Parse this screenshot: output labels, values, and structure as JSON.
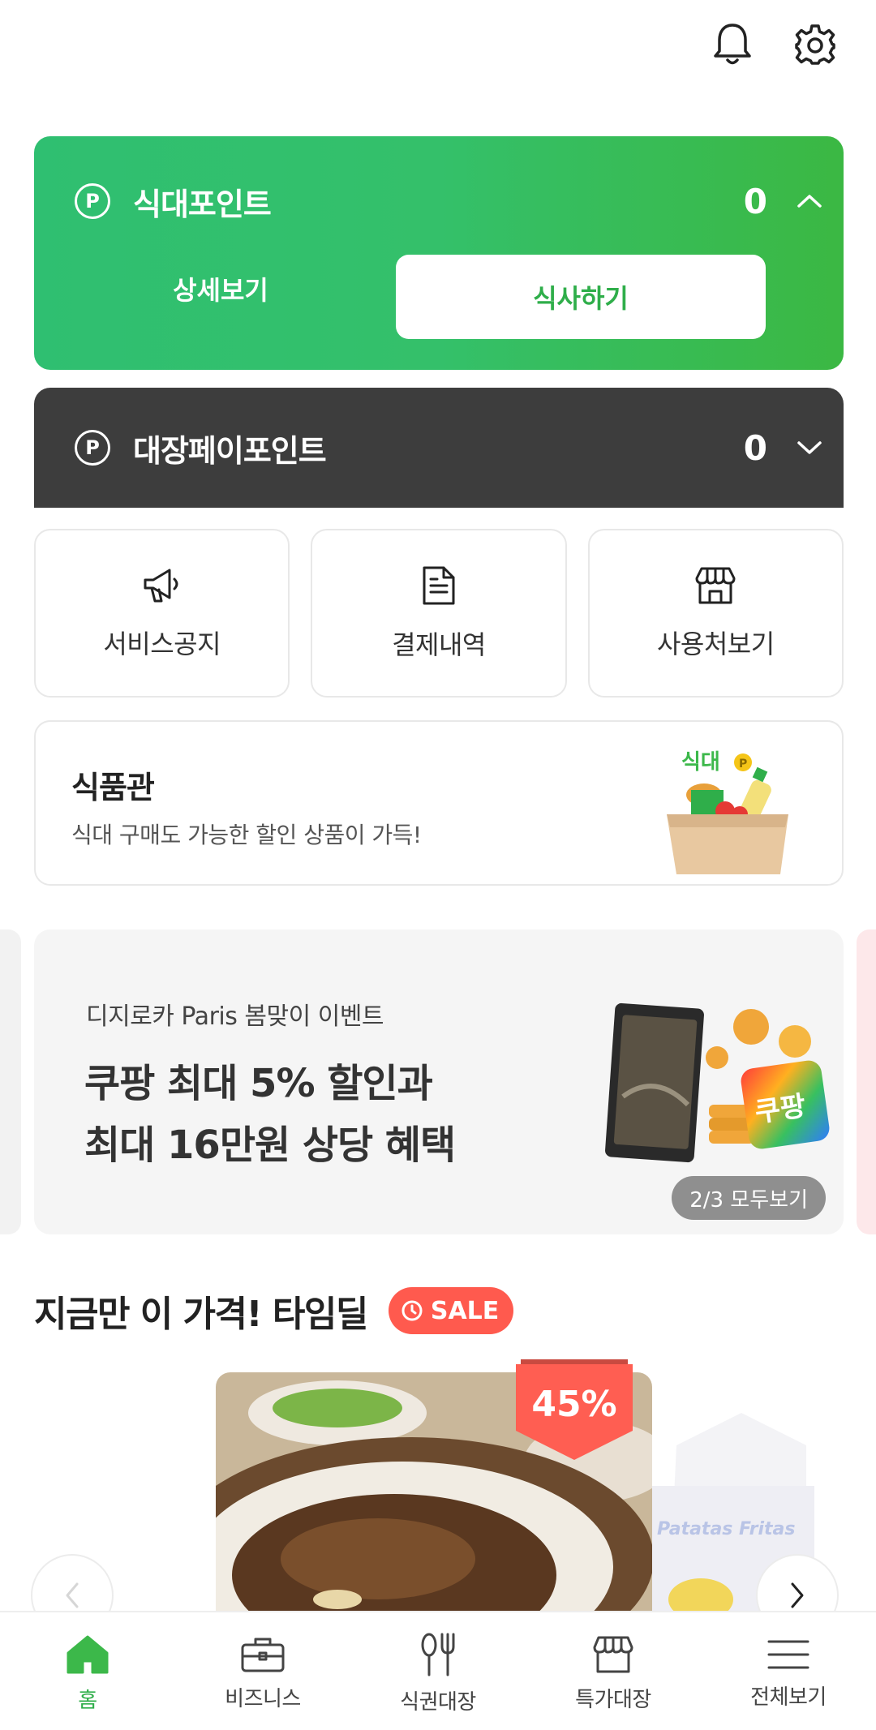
{
  "header": {
    "notification_icon": "bell-icon",
    "settings_icon": "gear-icon"
  },
  "sikdae_point": {
    "icon_letter": "P",
    "title": "식대포인트",
    "value": "0",
    "detail_label": "상세보기",
    "eat_label": "식사하기",
    "accent_color": "#34c06a"
  },
  "daejang_pay_point": {
    "icon_letter": "P",
    "title": "대장페이포인트",
    "value": "0",
    "color": "#3d3d3d"
  },
  "quick_menu": [
    {
      "label": "서비스공지",
      "icon": "megaphone-icon"
    },
    {
      "label": "결제내역",
      "icon": "receipt-icon"
    },
    {
      "label": "사용처보기",
      "icon": "store-icon"
    }
  ],
  "food_hall": {
    "title": "식품관",
    "subtitle": "식대 구매도 가능한 할인 상품이 가득!",
    "image_tag": "식대"
  },
  "banner": {
    "subtitle": "디지로카 Paris 봄맞이 이벤트",
    "title_line1": "쿠팡 최대 5% 할인과",
    "title_line2": "최대 16만원 상당 혜택",
    "pager": "2/3 모두보기",
    "art_text": "쿠팡"
  },
  "time_deal": {
    "title": "지금만 이 가격! 타임딜",
    "sale_badge": "SALE",
    "discount": "45%",
    "next_item_text": "Patatas Fritas"
  },
  "bottom_nav": [
    {
      "label": "홈",
      "icon": "home-icon",
      "active": true
    },
    {
      "label": "비즈니스",
      "icon": "briefcase-icon",
      "active": false
    },
    {
      "label": "식권대장",
      "icon": "utensils-icon",
      "active": false
    },
    {
      "label": "특가대장",
      "icon": "shop-icon",
      "active": false
    },
    {
      "label": "전체보기",
      "icon": "menu-icon",
      "active": false
    }
  ]
}
